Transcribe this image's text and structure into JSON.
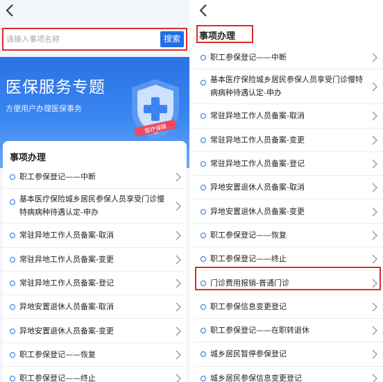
{
  "left": {
    "search": {
      "placeholder": "请输入事项名称",
      "button_label": "搜索"
    },
    "banner": {
      "title": "医保服务专题",
      "subtitle": "方便用户办理医保事务",
      "shield_text": "医疗保障"
    },
    "section_title": "事项办理",
    "items": [
      {
        "label": "职工参保登记——中断"
      },
      {
        "label": "基本医疗保险城乡居民参保人员享受门诊慢特病病种待遇认定-申办"
      },
      {
        "label": "常驻异地工作人员备案-取消"
      },
      {
        "label": "常驻异地工作人员备案-变更"
      },
      {
        "label": "常驻异地工作人员备案-登记"
      },
      {
        "label": "异地安置退休人员备案-取消"
      },
      {
        "label": "异地安置退休人员备案-变更"
      },
      {
        "label": "职工参保登记——恢复"
      },
      {
        "label": "职工参保登记——终止"
      }
    ]
  },
  "right": {
    "section_title": "事项办理",
    "items": [
      {
        "label": "职工参保登记——中断"
      },
      {
        "label": "基本医疗保险城乡居民参保人员享受门诊慢特病病种待遇认定-申办"
      },
      {
        "label": "常驻异地工作人员备案-取消"
      },
      {
        "label": "常驻异地工作人员备案-变更"
      },
      {
        "label": "常驻异地工作人员备案-登记"
      },
      {
        "label": "异地安置退休人员备案-取消"
      },
      {
        "label": "异地安置退休人员备案-变更"
      },
      {
        "label": "职工参保登记——恢复"
      },
      {
        "label": "职工参保登记——终止"
      },
      {
        "label": "门诊费用报销-普通门诊"
      },
      {
        "label": "职工参保信息变更登记"
      },
      {
        "label": "职工参保登记——在职转退休"
      },
      {
        "label": "城乡居民暂停参保登记"
      },
      {
        "label": "城乡居民参保信息变更登记"
      }
    ]
  },
  "colors": {
    "accent": "#1f6fe6",
    "highlight": "#e02b2b",
    "banner": "#2a72e6"
  },
  "icons": {
    "back": "chevron-left-icon",
    "row": "chevron-right-icon",
    "bullet": "circle-outline-icon",
    "banner": "shield-cross-icon"
  }
}
